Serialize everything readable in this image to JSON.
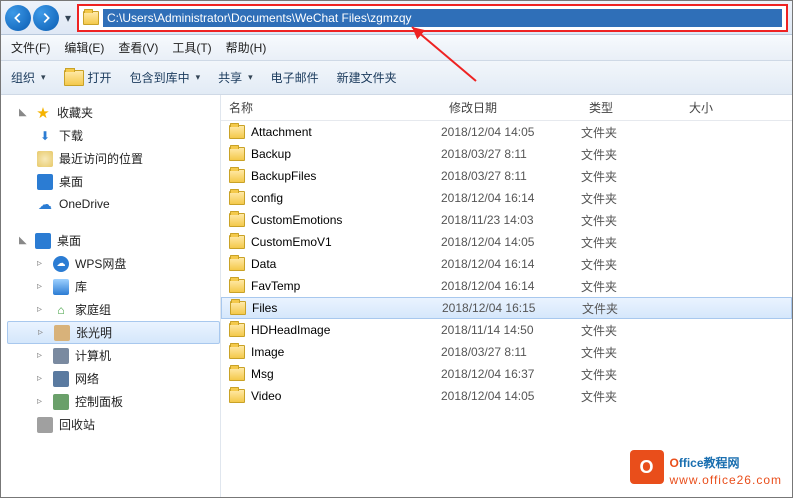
{
  "address": {
    "path": "C:\\Users\\Administrator\\Documents\\WeChat Files\\zgmzqy"
  },
  "menu": {
    "file": "文件(F)",
    "edit": "编辑(E)",
    "view": "查看(V)",
    "tools": "工具(T)",
    "help": "帮助(H)"
  },
  "toolbar": {
    "organize": "组织",
    "open": "打开",
    "include": "包含到库中",
    "share": "共享",
    "email": "电子邮件",
    "new_folder": "新建文件夹"
  },
  "sidebar": {
    "favorites": {
      "label": "收藏夹"
    },
    "downloads": {
      "label": "下载"
    },
    "recent": {
      "label": "最近访问的位置"
    },
    "desktop1": {
      "label": "桌面"
    },
    "onedrive": {
      "label": "OneDrive"
    },
    "desktop2": {
      "label": "桌面"
    },
    "wps": {
      "label": "WPS网盘"
    },
    "libraries": {
      "label": "库"
    },
    "homegroup": {
      "label": "家庭组"
    },
    "user": {
      "label": "张光明"
    },
    "computer": {
      "label": "计算机"
    },
    "network": {
      "label": "网络"
    },
    "control": {
      "label": "控制面板"
    },
    "recycle": {
      "label": "回收站"
    }
  },
  "columns": {
    "name": "名称",
    "date": "修改日期",
    "type": "类型",
    "size": "大小"
  },
  "rows": [
    {
      "name": "Attachment",
      "date": "2018/12/04 14:05",
      "type": "文件夹"
    },
    {
      "name": "Backup",
      "date": "2018/03/27 8:11",
      "type": "文件夹"
    },
    {
      "name": "BackupFiles",
      "date": "2018/03/27 8:11",
      "type": "文件夹"
    },
    {
      "name": "config",
      "date": "2018/12/04 16:14",
      "type": "文件夹"
    },
    {
      "name": "CustomEmotions",
      "date": "2018/11/23 14:03",
      "type": "文件夹"
    },
    {
      "name": "CustomEmoV1",
      "date": "2018/12/04 14:05",
      "type": "文件夹"
    },
    {
      "name": "Data",
      "date": "2018/12/04 16:14",
      "type": "文件夹"
    },
    {
      "name": "FavTemp",
      "date": "2018/12/04 16:14",
      "type": "文件夹"
    },
    {
      "name": "Files",
      "date": "2018/12/04 16:15",
      "type": "文件夹"
    },
    {
      "name": "HDHeadImage",
      "date": "2018/11/14 14:50",
      "type": "文件夹"
    },
    {
      "name": "Image",
      "date": "2018/03/27 8:11",
      "type": "文件夹"
    },
    {
      "name": "Msg",
      "date": "2018/12/04 16:37",
      "type": "文件夹"
    },
    {
      "name": "Video",
      "date": "2018/12/04 14:05",
      "type": "文件夹"
    }
  ],
  "selected_row": 8,
  "watermark": {
    "brand_o": "O",
    "brand_rest": "ffice教程网",
    "url": "www.office26.com"
  }
}
